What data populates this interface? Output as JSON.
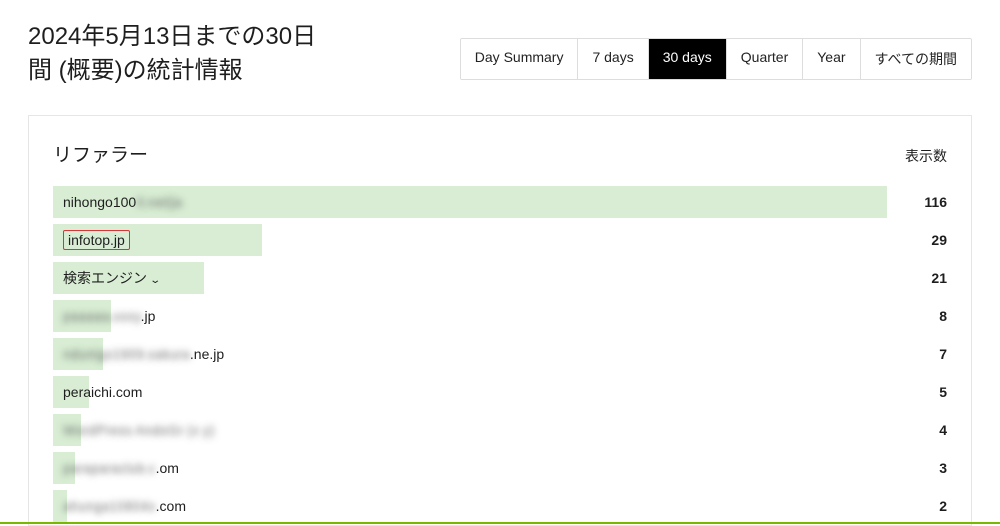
{
  "header": {
    "title": "2024年5月13日までの30日間 (概要)の統計情報"
  },
  "tabs": {
    "items": [
      {
        "label": "Day Summary",
        "active": false
      },
      {
        "label": "7 days",
        "active": false
      },
      {
        "label": "30 days",
        "active": true
      },
      {
        "label": "Quarter",
        "active": false
      },
      {
        "label": "Year",
        "active": false
      },
      {
        "label": "すべての期間",
        "active": false
      }
    ]
  },
  "card": {
    "title": "リファラー",
    "views_label": "表示数"
  },
  "referrers": [
    {
      "clear": "nihongo100",
      "blur": "0.net/ja",
      "value": 116,
      "bar_pct": 100.0,
      "highlight": false,
      "expandable": false
    },
    {
      "clear": "infotop.jp",
      "blur": "",
      "value": 29,
      "bar_pct": 25.0,
      "highlight": true,
      "expandable": false
    },
    {
      "clear": "検索エンジン",
      "blur": "",
      "value": 21,
      "bar_pct": 18.1,
      "highlight": false,
      "expandable": true
    },
    {
      "clear": ".jp",
      "blur": "paaaaa.xxxy",
      "value": 8,
      "bar_pct": 6.9,
      "highlight": false,
      "expandable": false,
      "blur_before": true
    },
    {
      "clear": ".ne.jp",
      "blur": "ndunigo1909.sakura",
      "value": 7,
      "bar_pct": 6.0,
      "highlight": false,
      "expandable": false,
      "blur_before": true
    },
    {
      "clear": "peraichi.com",
      "blur": "",
      "value": 5,
      "bar_pct": 4.3,
      "highlight": false,
      "expandable": false
    },
    {
      "clear": "",
      "blur": "WordPress AndoGr (x y)",
      "value": 4,
      "bar_pct": 3.4,
      "highlight": false,
      "expandable": false
    },
    {
      "clear": ".om",
      "blur": "paraparaclub.c",
      "value": 3,
      "bar_pct": 2.6,
      "highlight": false,
      "expandable": false,
      "blur_before": true
    },
    {
      "clear": ".com",
      "blur": "ahunga10804x",
      "value": 2,
      "bar_pct": 1.7,
      "highlight": false,
      "expandable": false,
      "blur_before": true
    }
  ],
  "chart_data": {
    "type": "bar",
    "title": "リファラー",
    "ylabel": "表示数",
    "categories": [
      "nihongo100…",
      "infotop.jp",
      "検索エンジン",
      "…y.jp",
      "….ne.jp",
      "peraichi.com",
      "(blurred)",
      "….om",
      "….com"
    ],
    "values": [
      116,
      29,
      21,
      8,
      7,
      5,
      4,
      3,
      2
    ]
  }
}
